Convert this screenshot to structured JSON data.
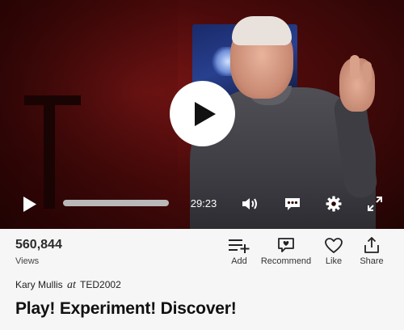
{
  "player": {
    "duration": "29:23",
    "progress": 0,
    "icons": {
      "overlay": "play-icon",
      "play": "play-icon",
      "volume": "volume-icon",
      "captions": "captions-icon",
      "settings": "gear-icon",
      "fullscreen": "fullscreen-icon"
    }
  },
  "stats": {
    "views_count": "560,844",
    "views_label": "Views"
  },
  "actions": {
    "add": {
      "label": "Add",
      "icon": "playlist-add-icon"
    },
    "recommend": {
      "label": "Recommend",
      "icon": "recommend-icon"
    },
    "like": {
      "label": "Like",
      "icon": "heart-icon"
    },
    "share": {
      "label": "Share",
      "icon": "share-icon"
    }
  },
  "talk": {
    "speaker": "Kary Mullis",
    "at": "at",
    "event": "TED2002",
    "title": "Play! Experiment! Discover!"
  },
  "colors": {
    "accent": "#ffffff",
    "background": "#f6f6f6",
    "progress_track": "#b9b9b9"
  }
}
